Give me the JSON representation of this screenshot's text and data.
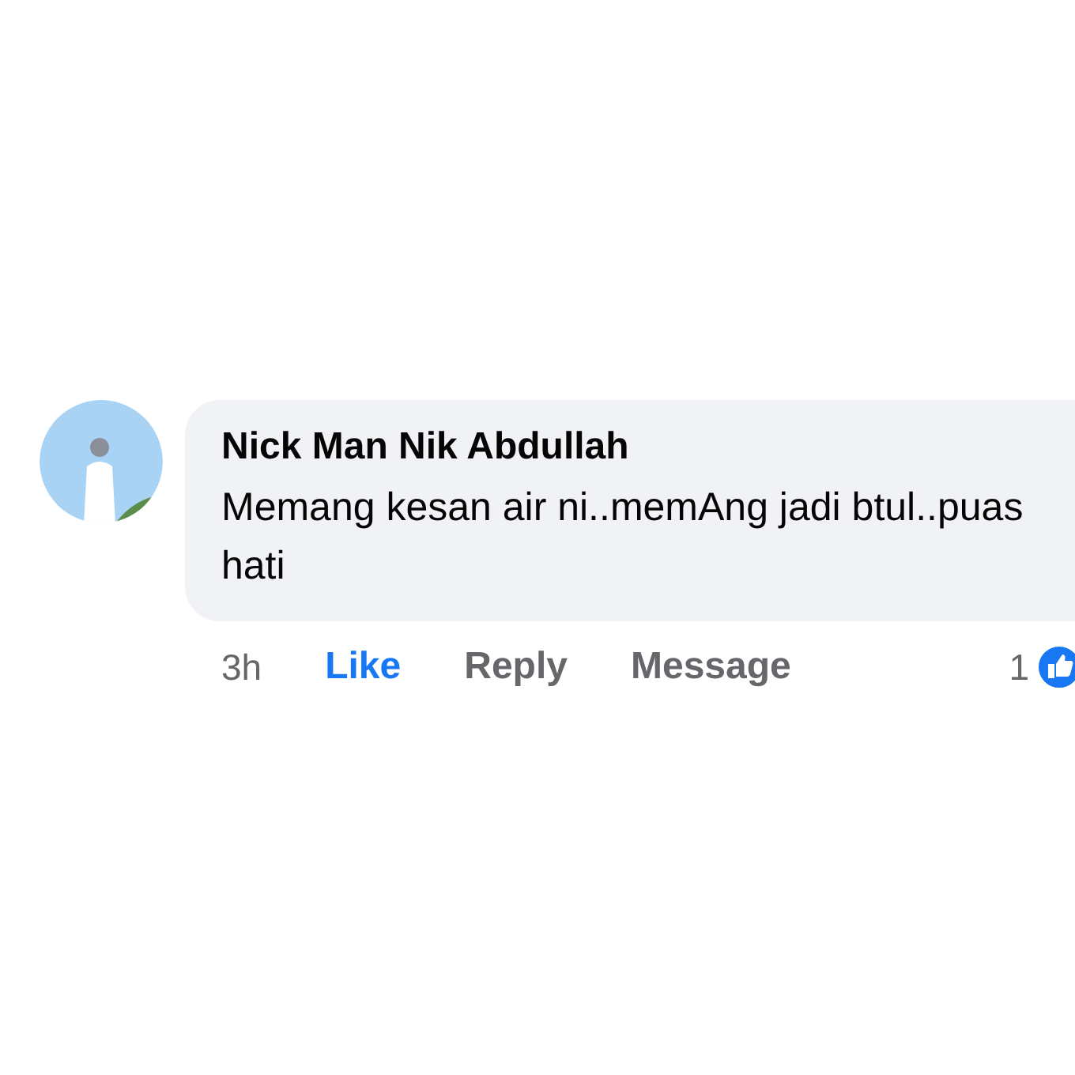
{
  "comment": {
    "author": "Nick Man Nik Abdullah",
    "text": "Memang kesan air ni..memAng jadi btul..puas hati",
    "time": "3h",
    "like": {
      "label": "Like",
      "selected": true
    },
    "actions": [
      "Reply",
      "Message"
    ],
    "reaction_count": "1"
  }
}
